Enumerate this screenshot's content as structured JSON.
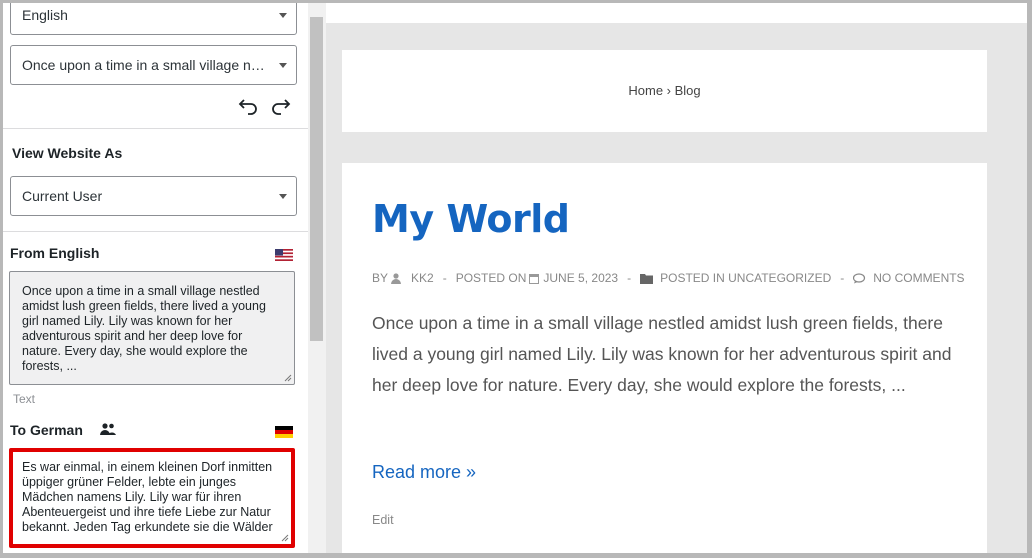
{
  "sidebar": {
    "language_select": {
      "value": "English"
    },
    "string_select": {
      "value": "Once upon a time in a small village nestled amidst lush green fields, there lived a young girl named Lily."
    },
    "view_as": {
      "heading": "View Website As",
      "value": "Current User"
    },
    "source": {
      "heading": "From English",
      "text": "Once upon a time in a small village nestled amidst lush green fields, there lived a young girl named Lily. Lily was known for her adventurous spirit and her deep love for nature. Every day, she would explore the forests, ...",
      "type_label": "Text"
    },
    "target": {
      "heading": "To German",
      "text": "Es war einmal, in einem kleinen Dorf inmitten üppiger grüner Felder, lebte ein junges Mädchen namens Lily. Lily war für ihren Abenteuergeist und ihre tiefe Liebe zur Natur bekannt. Jeden Tag erkundete sie die Wälder"
    }
  },
  "preview": {
    "breadcrumb": "Home › Blog",
    "post": {
      "title": "My World",
      "by_label": "BY",
      "author": "KK2",
      "posted_on_label": "POSTED ON",
      "date": "JUNE 5, 2023",
      "posted_in": "POSTED IN UNCATEGORIZED",
      "comments": "NO COMMENTS",
      "separator": "-",
      "excerpt": "Once upon a time in a small village nestled amidst lush green fields, there lived a young girl named Lily. Lily was known for her adventurous spirit and her deep love for nature. Every day, she would explore the forests, ...",
      "read_more": "Read more »",
      "edit": "Edit"
    }
  },
  "colors": {
    "accent": "#1565c0",
    "highlight_border": "#e00000"
  }
}
